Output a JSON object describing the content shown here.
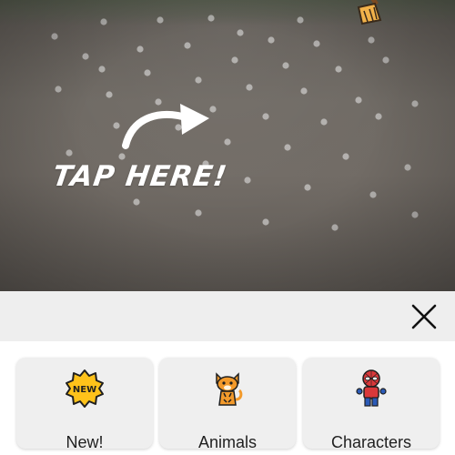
{
  "camera": {
    "hint_text": "TAP HERE!"
  },
  "icons": {
    "close": "close-icon",
    "arrow": "curved-arrow-icon",
    "broom": "broom-icon"
  },
  "categories": [
    {
      "label": "New!",
      "icon": "new-badge-icon",
      "badge_text": "NEW"
    },
    {
      "label": "Animals",
      "icon": "tiger-icon"
    },
    {
      "label": "Characters",
      "icon": "spider-hero-icon"
    }
  ],
  "colors": {
    "sheet_header_bg": "#eeeeee",
    "card_bg": "#efefef",
    "new_badge": "#ffc21a",
    "hero_red": "#d9383a",
    "tiger_orange": "#f39a2b"
  }
}
